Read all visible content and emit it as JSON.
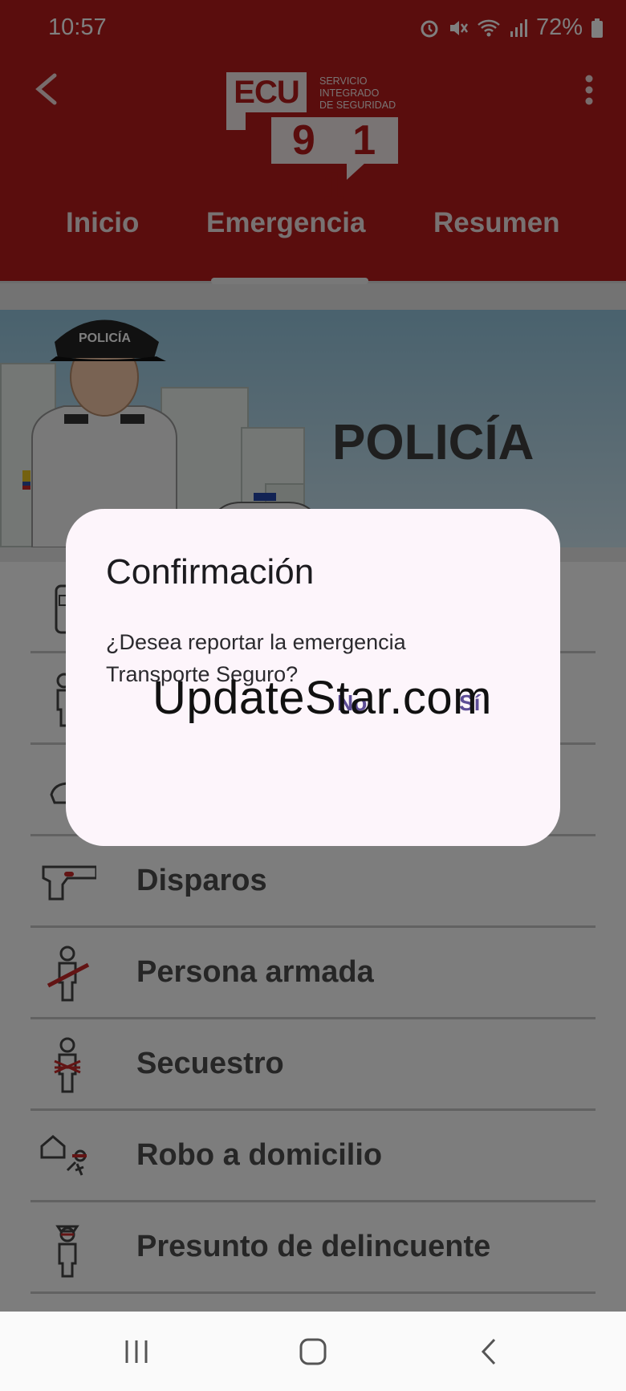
{
  "status_bar": {
    "time": "10:57",
    "battery": "72%"
  },
  "header": {
    "logo": {
      "ecu": "ECU",
      "number": "9 1 1",
      "line1": "SERVICIO",
      "line2": "INTEGRADO",
      "line3": "DE SEGURIDAD"
    },
    "tabs": [
      {
        "label": "Inicio"
      },
      {
        "label": "Emergencia",
        "selected": true
      },
      {
        "label": "Resumen"
      }
    ]
  },
  "banner": {
    "title": "POLICÍA",
    "cap_text": "POLICÍA"
  },
  "list": {
    "items": [
      {
        "label": "",
        "icon": "van-icon"
      },
      {
        "label": "",
        "icon": "person-icon"
      },
      {
        "label": "",
        "icon": "bag-icon"
      },
      {
        "label": "Disparos",
        "icon": "pistol-icon"
      },
      {
        "label": "Persona armada",
        "icon": "armed-person-icon"
      },
      {
        "label": "Secuestro",
        "icon": "kidnapping-icon"
      },
      {
        "label": "Robo a domicilio",
        "icon": "burglary-icon"
      },
      {
        "label": "Presunto de delincuente",
        "icon": "suspect-icon"
      }
    ]
  },
  "dialog": {
    "title": "Confirmación",
    "message": "¿Desea reportar la emergencia Transporte Seguro?",
    "no_label": "No",
    "yes_label": "Sí"
  },
  "watermark": "UpdateStar.com",
  "colors": {
    "header_red": "#b51b1a",
    "dialog_bg": "#fdf5fb",
    "dialog_button": "#5d4d96"
  }
}
